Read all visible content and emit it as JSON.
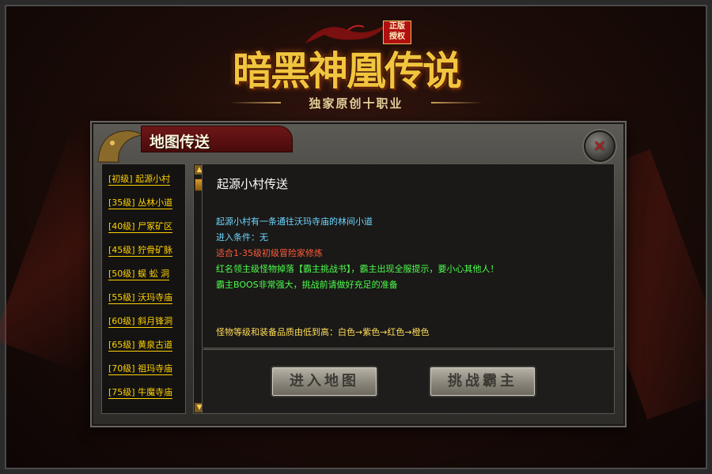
{
  "logo": {
    "title": "暗黑神凰传说",
    "subtitle": "独家原创十职业",
    "badge_line1": "正版",
    "badge_line2": "授权"
  },
  "dialog": {
    "title": "地图传送",
    "close_symbol": "✕"
  },
  "map_list": {
    "items": [
      {
        "label": "[初级] 起源小村"
      },
      {
        "label": "[35级] 丛林小道"
      },
      {
        "label": "[40级] 尸冢矿区"
      },
      {
        "label": "[45级] 狞骨矿脉"
      },
      {
        "label": "[50级] 蜈 蚣 洞"
      },
      {
        "label": "[55级] 沃玛寺庙"
      },
      {
        "label": "[60级] 斜月锋洞"
      },
      {
        "label": "[65级] 黄泉古道"
      },
      {
        "label": "[70级] 祖玛寺庙"
      },
      {
        "label": "[75级] 牛魔寺庙"
      }
    ],
    "scroll_up": "▲",
    "scroll_down": "▼"
  },
  "info": {
    "title": "起源小村传送",
    "lines": [
      {
        "text": "起源小村有一条通往沃玛寺庙的林间小道",
        "color": "#6ed6ff"
      },
      {
        "text": "进入条件：无",
        "color": "#6ed6ff"
      },
      {
        "text": "适合1-35级初级冒险家修炼",
        "color": "#ff5a3c"
      },
      {
        "text": "红名领主级怪物掉落【霸主挑战书】，霸主出现全服提示，要小心其他人！",
        "color": "#4dff4d"
      },
      {
        "text": "霸主BOOS非常强大，挑战前请做好充足的准备",
        "color": "#4dff4d"
      },
      {
        "text": "怪物等级和装备品质由低到高：白色→紫色→红色→橙色",
        "color": "#ffdc5a"
      }
    ]
  },
  "actions": {
    "enter_label": "进入地图",
    "challenge_label": "挑战霸主"
  }
}
